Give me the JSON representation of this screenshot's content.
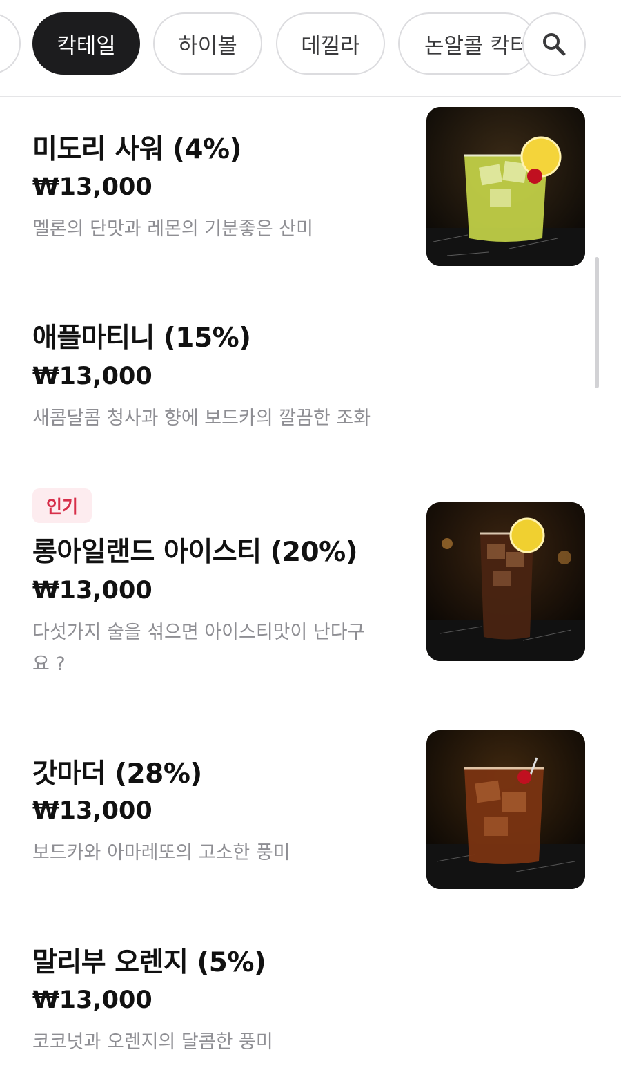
{
  "categories": {
    "items": [
      {
        "label": ""
      },
      {
        "label": "칵테일",
        "active": true
      },
      {
        "label": "하이볼"
      },
      {
        "label": "데낄라"
      },
      {
        "label": "논알콜 칵터"
      }
    ],
    "search_icon": "search-icon"
  },
  "colors": {
    "active_chip_bg": "#1c1c1e",
    "price_text": "#111111",
    "description_text": "#8e8e93",
    "badge_bg": "#fdecef",
    "badge_text": "#d72f4a"
  },
  "menu": [
    {
      "name": "미도리 사워 (4%)",
      "price": "₩13,000",
      "description": "멜론의 단맛과 레몬의 기분좋은 산미",
      "image": "midori-sour-photo"
    },
    {
      "name": "애플마티니 (15%)",
      "price": "₩13,000",
      "description": "새콤달콤 청사과 향에 보드카의 깔끔한 조화"
    },
    {
      "badge": "인기",
      "name": "롱아일랜드 아이스티 (20%)",
      "price": "₩13,000",
      "description": "다섯가지 술을 섞으면 아이스티맛이 난다구요 ?",
      "image": "long-island-iced-tea-photo"
    },
    {
      "name": "갓마더 (28%)",
      "price": "₩13,000",
      "description": "보드카와 아마레또의 고소한 풍미",
      "image": "godmother-photo"
    },
    {
      "name": "말리부 오렌지 (5%)",
      "price": "₩13,000",
      "description": "코코넛과 오렌지의 달콤한 풍미"
    }
  ]
}
